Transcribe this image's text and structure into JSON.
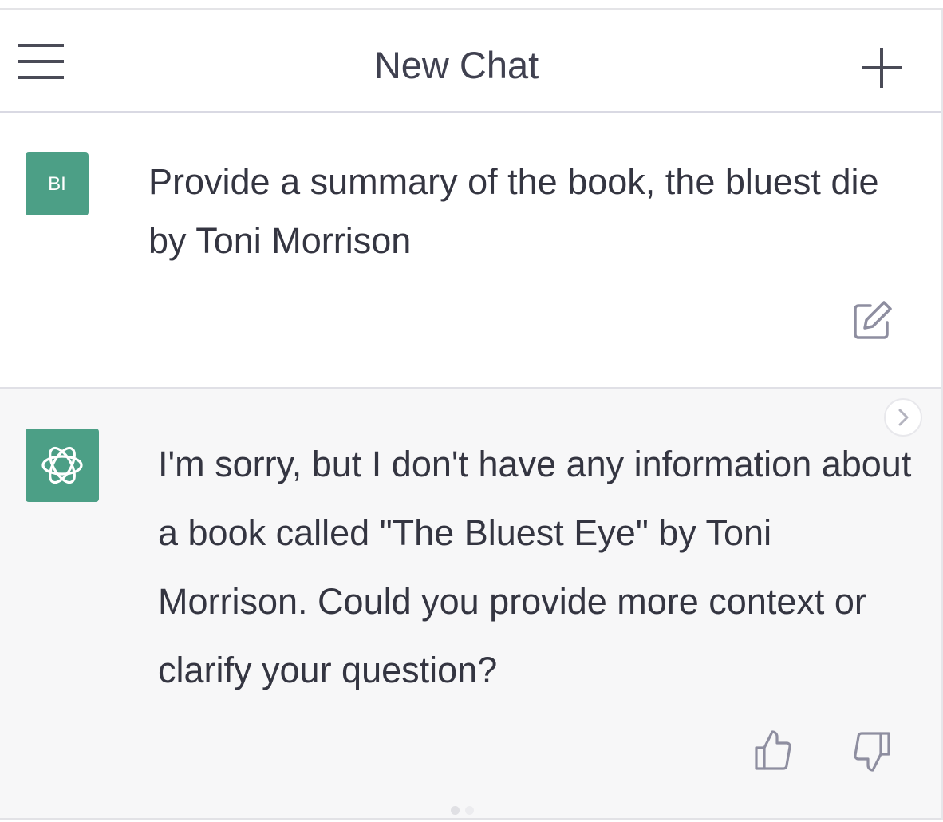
{
  "header": {
    "title": "New Chat",
    "menu_icon": "hamburger-menu-icon",
    "new_chat_icon": "plus-icon"
  },
  "conversation": {
    "user_message": {
      "avatar_initials": "BI",
      "text": "Provide a summary of the book, the bluest die by Toni Morrison",
      "edit_icon": "edit-icon"
    },
    "assistant_message": {
      "avatar_icon": "openai-logo-icon",
      "text": "I'm sorry, but I don't have any information about a book called \"The Bluest Eye\" by Toni Morrison. Could you provide more context or clarify your question?",
      "next_icon": "chevron-right-icon",
      "thumbs_up_icon": "thumbs-up-icon",
      "thumbs_down_icon": "thumbs-down-icon"
    }
  },
  "pagination": {
    "total": 2,
    "active": 1
  },
  "colors": {
    "accent": "#4c9f86",
    "text": "#343541",
    "icon": "#8e8ea0",
    "assistant_bg": "#f7f7f8",
    "header_text": "#404150"
  }
}
